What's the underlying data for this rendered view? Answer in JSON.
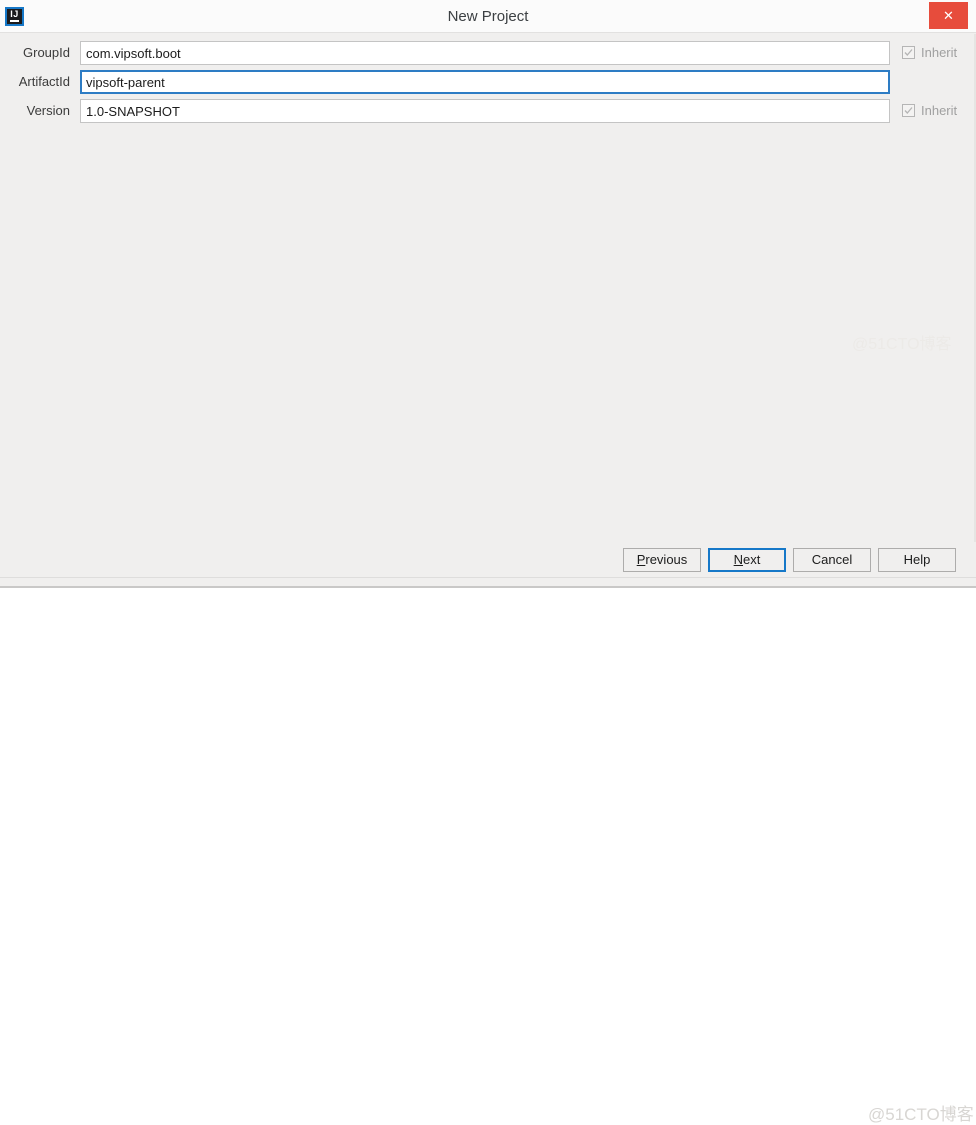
{
  "window": {
    "title": "New Project",
    "app_icon": "intellij-idea-icon",
    "icon_letters": "IJ",
    "close_label": "✕",
    "accent_color": "#1678c8",
    "close_color": "#e74c3c",
    "background_color": "#f0efee"
  },
  "form": {
    "fields": [
      {
        "label": "GroupId",
        "value": "com.vipsoft.boot",
        "placeholder": "",
        "focused": false,
        "inherit": {
          "label": "Inherit",
          "checked": true,
          "enabled": false
        }
      },
      {
        "label": "ArtifactId",
        "value": "vipsoft-parent",
        "placeholder": "",
        "focused": true,
        "inherit": null
      },
      {
        "label": "Version",
        "value": "1.0-SNAPSHOT",
        "placeholder": "",
        "focused": false,
        "inherit": {
          "label": "Inherit",
          "checked": true,
          "enabled": false
        }
      }
    ]
  },
  "buttons": {
    "previous": {
      "label": "Previous",
      "mnemonic": "P",
      "default": false
    },
    "next": {
      "label": "Next",
      "mnemonic": "N",
      "default": true
    },
    "cancel": {
      "label": "Cancel",
      "mnemonic": "",
      "default": false
    },
    "help": {
      "label": "Help",
      "mnemonic": "",
      "default": false
    }
  },
  "watermark": {
    "text": "@51CTO博客",
    "text_mid": "@51CTO博客"
  }
}
